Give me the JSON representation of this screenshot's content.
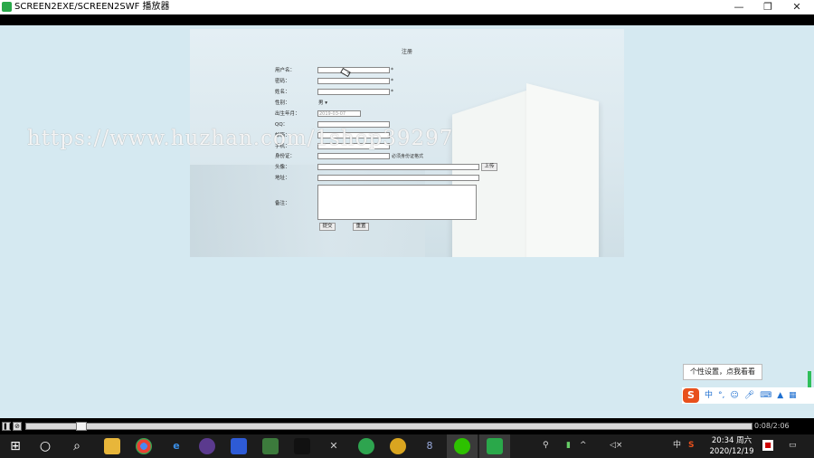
{
  "window": {
    "title": "SCREEN2EXE/SCREEN2SWF 播放器",
    "minimize_icon": "—",
    "restore_icon": "❐",
    "close_icon": "✕"
  },
  "form": {
    "title": "注册",
    "username_label": "用户名：",
    "password_label": "密码：",
    "name_label": "姓名：",
    "gender_label": "性别：",
    "gender_value": "男 ▾",
    "birthday_label": "出生年月：",
    "birthday_value": "2019-03-07",
    "qq_label": "QQ：",
    "email_label": "邮箱：",
    "phone_label": "手机：",
    "idcard_label": "身份证：",
    "idcard_hint": "必须身份证格式",
    "avatar_label": "头像：",
    "upload_label": "上传",
    "address_label": "地址：",
    "remark_label": "备注：",
    "submit_label": "提交",
    "reset_label": "重置",
    "required_mark": "*"
  },
  "watermark": "https://www.huzhan.com/1shop39297",
  "ime": {
    "tooltip": "个性设置，点我看看",
    "logo": "S",
    "mode": "中"
  },
  "player": {
    "pause_icon": "❚❚",
    "stop_icon": "⊘",
    "time": "0:08/2:06",
    "progress": 0.07
  },
  "taskbar": {
    "start_icon": "⊞",
    "cortana_icon": "○",
    "search_icon": "⌕",
    "clock_time": "20:34 周六",
    "clock_date": "2020/12/19",
    "ime_lang": "中"
  }
}
